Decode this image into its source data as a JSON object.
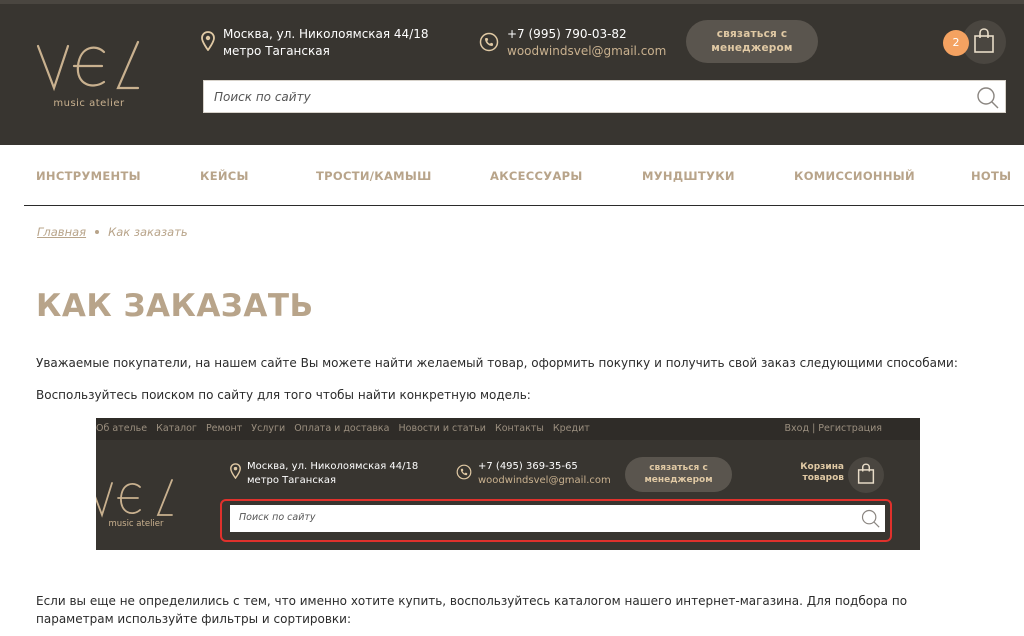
{
  "header": {
    "logo_text": "music atelier",
    "address_line1": "Москва, ул. Николоямская 44/18",
    "address_line2": "метро Таганская",
    "phone": "+7 (995) 790-03-82",
    "email": "woodwindsvel@gmail.com",
    "contact_button_line1": "связаться с",
    "contact_button_line2": "менеджером",
    "cart_count": "2",
    "search_placeholder": "Поиск по сайту"
  },
  "nav": {
    "items": [
      {
        "label": "ИНСТРУМЕНТЫ"
      },
      {
        "label": "КЕЙСЫ"
      },
      {
        "label": "ТРОСТИ/КАМЫШ"
      },
      {
        "label": "АКСЕССУАРЫ"
      },
      {
        "label": "МУНДШТУКИ"
      },
      {
        "label": "КОМИССИОННЫЙ"
      },
      {
        "label": "НОТЫ"
      }
    ]
  },
  "breadcrumb": {
    "home": "Главная",
    "current": "Как заказать"
  },
  "content": {
    "title": "КАК ЗАКАЗАТЬ",
    "para1": "Уважаемые покупатели, на нашем сайте Вы можете найти желаемый товар, оформить покупку и получить свой заказ следующими способами:",
    "para2": "Воспользуйтесь поиском по сайту для того чтобы найти конкретную модель:",
    "para3": "Если вы еще не определились с тем, что именно хотите купить, воспользуйтесь каталогом нашего интернет-магазина. Для подбора по параметрам используйте фильтры и сортировки:"
  },
  "screenshot": {
    "menu": [
      "Об ателье",
      "Каталог",
      "Ремонт",
      "Услуги",
      "Оплата и доставка",
      "Новости и статьи",
      "Контакты",
      "Кредит"
    ],
    "login": "Вход | Регистрация",
    "logo_text": "music atelier",
    "address_line1": "Москва, ул. Николоямская 44/18",
    "address_line2": "метро Таганская",
    "phone": "+7 (495) 369-35-65",
    "email": "woodwindsvel@gmail.com",
    "button_line1": "связаться с",
    "button_line2": "менеджером",
    "cart_line1": "Корзина",
    "cart_line2": "товаров",
    "search_placeholder": "Поиск по сайту"
  },
  "colors": {
    "header_bg": "#383530",
    "accent": "#b8a48a",
    "badge": "#f4a261",
    "highlight": "#e0312c"
  }
}
